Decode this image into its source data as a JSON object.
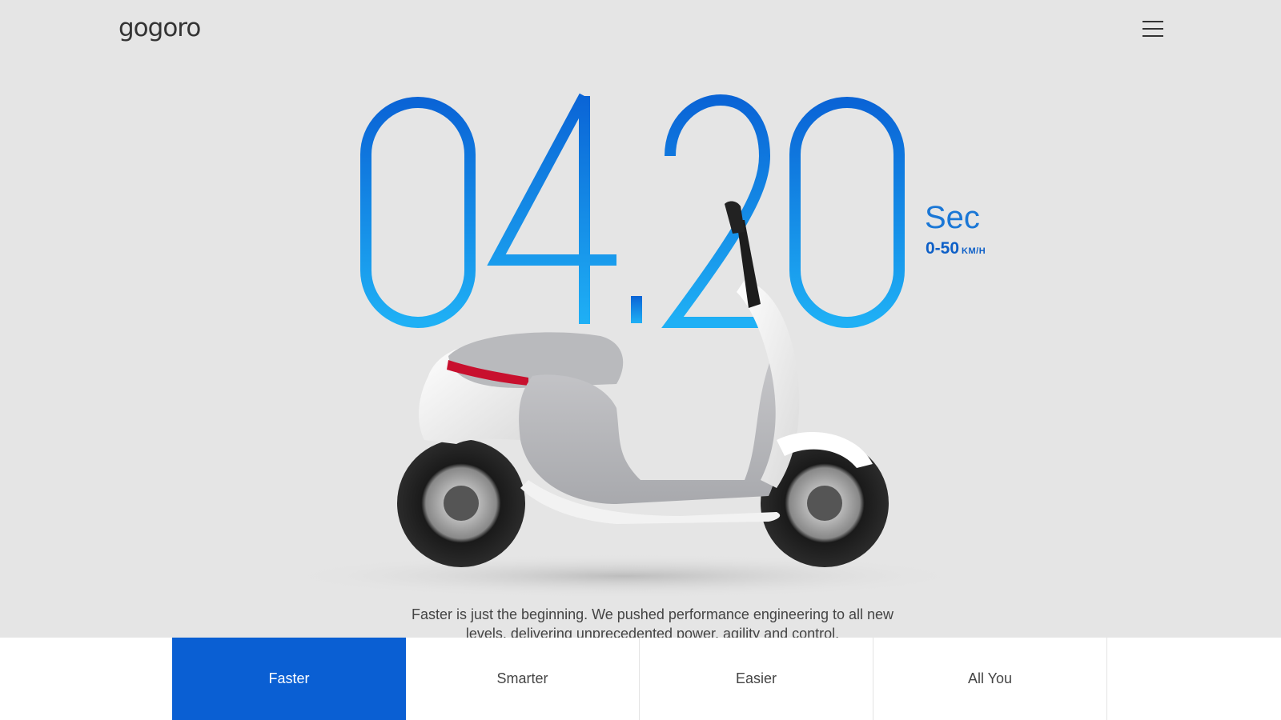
{
  "header": {
    "logo_text": "gogoro",
    "menu_icon": "hamburger-menu-icon"
  },
  "hero": {
    "big_number": "04.20",
    "unit": "Sec",
    "range": "0-50",
    "range_unit": "KM/H",
    "description": "Faster is just the beginning. We pushed performance engineering to all new levels, delivering unprecedented power, agility and control."
  },
  "colors": {
    "background": "#e5e5e5",
    "number_gradient_top": "#0a64d6",
    "number_gradient_bottom": "#1fb0f5",
    "active_tab": "#0a5fd3"
  },
  "tabs": [
    {
      "label": "Faster",
      "active": true
    },
    {
      "label": "Smarter",
      "active": false
    },
    {
      "label": "Easier",
      "active": false
    },
    {
      "label": "All You",
      "active": false
    }
  ]
}
